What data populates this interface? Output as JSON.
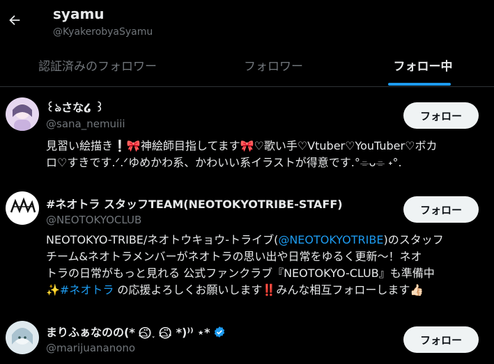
{
  "header": {
    "title": "syamu",
    "handle": "@KyakerobyaSyamu"
  },
  "tabs": [
    {
      "label": "認証済みのフォロワー"
    },
    {
      "label": "フォロワー"
    },
    {
      "label": "フォロー中"
    }
  ],
  "users": [
    {
      "name": "꒰ঌさな໒ ꒱",
      "handle": "@sana_nemuiii",
      "follow_label": "フォロー",
      "bio_lines": [
        "見習い絵描き❕🎀神絵師目指してます🎀♡歌い手♡Vtuber♡YouTuber♡ボカ",
        "ロ♡すきです.ᐟ.ᐟゆめかわ系、かわいい系イラストが得意です.°⌯ᴗ⌯ ˖°."
      ]
    },
    {
      "name": "#ネオトラ スタッフTEAM(NEOTOKYOTRIBE-STAFF)",
      "handle": "@NEOTOKYOCLUB",
      "follow_label": "フォロー",
      "bio_line1_pre": "NEOTOKYO-TRIBE/ネオトウキョウ-トライブ(",
      "bio_line1_link": "@NEOTOKYOTRIBE",
      "bio_line1_post": ")のスタッフ",
      "bio_line2": "チーム&ネオトラメンバーがネオトラの思い出や日常をゆるく更新〜！ネオ",
      "bio_line3": "トラの日常がもっと見れる 公式ファンクラブ『NEOTOKYO-CLUB』も準備中",
      "bio_line4_pre": "✨",
      "bio_line4_link": "#ネオトラ",
      "bio_line4_post": " の応援よろしくお願いします‼️みんな相互フォローします👍🏻"
    },
    {
      "name": "まりふぁなのの(* ⌓̈⃝⃝⃝⃝⃝⃝ ˯ ⌓̈⃝⃝⃝⃝⃝⃝. *)⁾⁾ ⋆*",
      "handle": "@marijuananono",
      "follow_label": "フォロー"
    }
  ],
  "colors": {
    "accent": "#1d9bf0",
    "text": "#e7e9ea",
    "muted": "#71767b",
    "background": "#000000"
  },
  "icons": {
    "back": "arrow-left",
    "verified": "verified-badge"
  }
}
